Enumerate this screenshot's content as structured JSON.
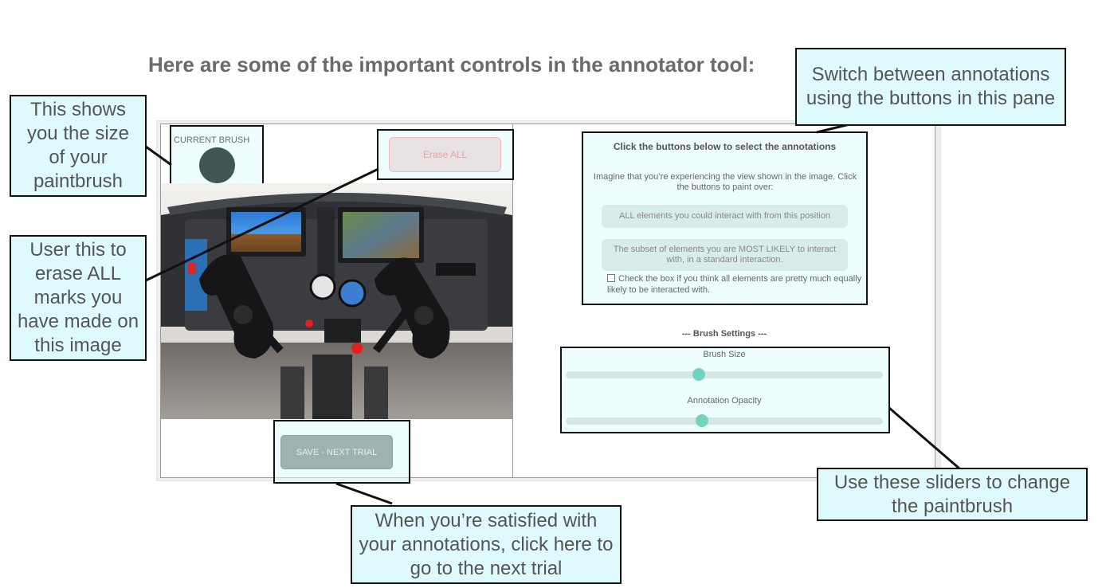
{
  "heading": "Here are some of the important controls in the annotator tool:",
  "tool": {
    "current_brush_label": "CURRENT BRUSH",
    "brush_color": "#3f5856",
    "erase_all_label": "Erase ALL",
    "save_next_label": "SAVE - NEXT TRIAL",
    "panel": {
      "title": "Click the buttons below to select the annotations",
      "instructions": "Imagine that you’re experiencing the view shown in the image. Click the buttons to paint over:",
      "option_all": "ALL elements you could interact with from this position",
      "option_likely": "The subset of elements you are MOST LIKELY to interact with, in a standard interaction.",
      "checkbox_label": "Check the box if you think all elements are pretty much equally likely to be interacted with.",
      "checkbox_checked": false
    },
    "brush_settings": {
      "title": "--- Brush Settings ---",
      "brush_size_label": "Brush Size",
      "brush_size_value": 0.42,
      "opacity_label": "Annotation Opacity",
      "opacity_value": 0.43
    }
  },
  "callouts": {
    "brush_size": "This shows you the size of your paintbrush",
    "erase_all": "User this to erase ALL marks you have made on this image",
    "switch_annotations": "Switch between annotations using the buttons in this pane",
    "sliders": "Use these sliders to change the paintbrush",
    "save_next": "When you’re satisfied with your annotations, click here to go to the next trial"
  },
  "colors": {
    "highlight_fill": "#dffafd",
    "slider_thumb": "#73d3bf",
    "erase_text": "#e8a2aa",
    "save_button": "#9cb3b1"
  }
}
